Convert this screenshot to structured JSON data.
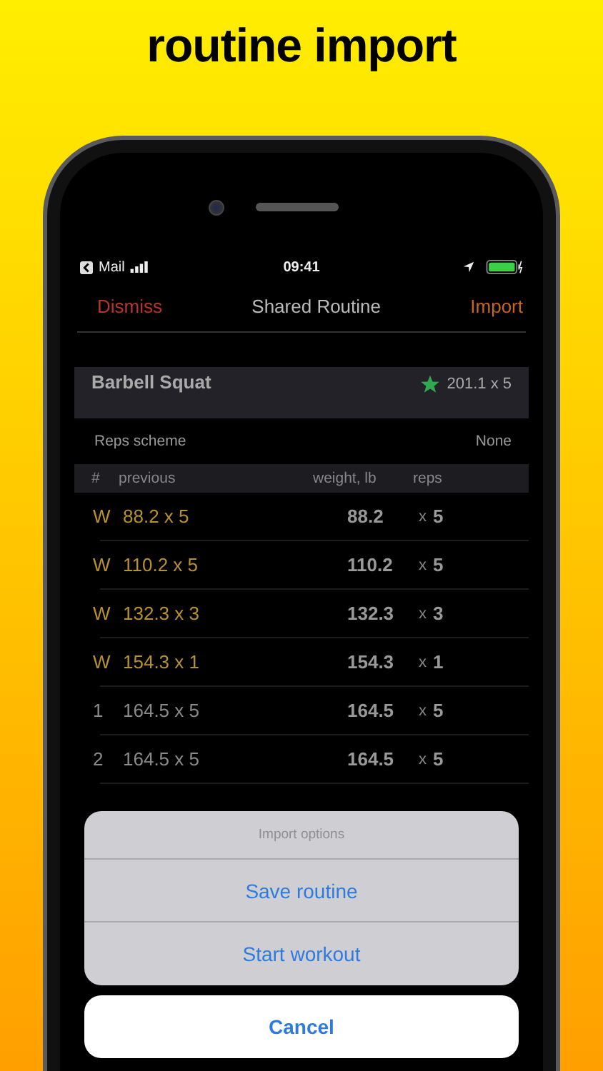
{
  "headline": "routine import",
  "status_bar": {
    "back_label": "Mail",
    "time": "09:41"
  },
  "nav": {
    "left": "Dismiss",
    "title": "Shared Routine",
    "right": "Import"
  },
  "exercise": {
    "name": "Barbell Squat",
    "best": "201.1 x 5"
  },
  "reps_scheme": {
    "label": "Reps scheme",
    "value": "None"
  },
  "table": {
    "columns": [
      "#",
      "previous",
      "weight, lb",
      "reps"
    ],
    "rows": [
      {
        "set": "W",
        "kind": "warmup",
        "previous": "88.2 x 5",
        "weight": "88.2",
        "times": "x",
        "reps": "5"
      },
      {
        "set": "W",
        "kind": "warmup",
        "previous": "110.2 x 5",
        "weight": "110.2",
        "times": "x",
        "reps": "5"
      },
      {
        "set": "W",
        "kind": "warmup",
        "previous": "132.3 x 3",
        "weight": "132.3",
        "times": "x",
        "reps": "3"
      },
      {
        "set": "W",
        "kind": "warmup",
        "previous": "154.3 x 1",
        "weight": "154.3",
        "times": "x",
        "reps": "1"
      },
      {
        "set": "1",
        "kind": "working",
        "previous": "164.5 x 5",
        "weight": "164.5",
        "times": "x",
        "reps": "5"
      },
      {
        "set": "2",
        "kind": "working",
        "previous": "164.5 x 5",
        "weight": "164.5",
        "times": "x",
        "reps": "5"
      }
    ]
  },
  "sheet": {
    "title": "Import options",
    "options": [
      "Save routine",
      "Start workout"
    ],
    "cancel": "Cancel"
  }
}
